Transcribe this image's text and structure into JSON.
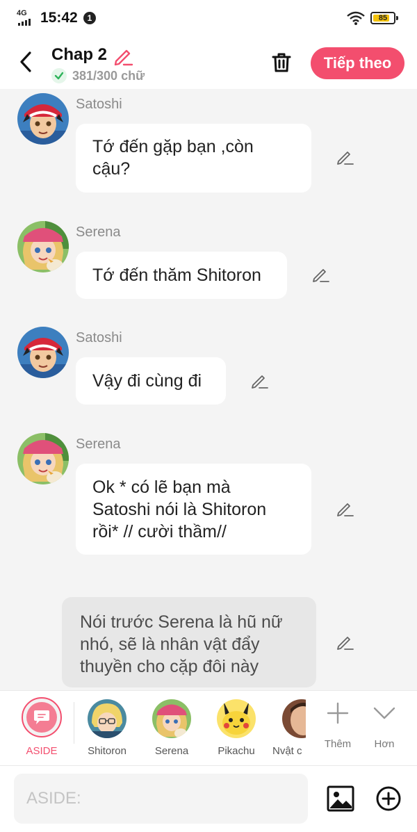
{
  "status_bar": {
    "network": "4G",
    "time": "15:42",
    "notification_count": "1",
    "battery": "85",
    "battery_level": 0.85
  },
  "header": {
    "title": "Chap 2",
    "word_count": "381/300 chữ",
    "next_label": "Tiếp theo"
  },
  "messages": [
    {
      "speaker": "Satoshi",
      "text_lines": [
        "Tớ đến gặp bạn ,còn",
        "cậu?"
      ],
      "avatar": "satoshi-avatar"
    },
    {
      "speaker": "Serena",
      "text_lines": [
        "Tớ đến thăm Shitoron"
      ],
      "avatar": "serena-avatar"
    },
    {
      "speaker": "Satoshi",
      "text_lines": [
        "Vậy đi cùng đi"
      ],
      "avatar": "satoshi-avatar"
    },
    {
      "speaker": "Serena",
      "text_lines": [
        "Ok * có lẽ bạn mà",
        "Satoshi nói là Shitoron",
        "rồi* // cười thầm//"
      ],
      "avatar": "serena-avatar"
    }
  ],
  "aside_message": {
    "text_lines": [
      "Nói trước Serena là hũ nữ",
      "nhó, sẽ là nhân vật đẩy",
      "thuyền cho cặp đôi này"
    ]
  },
  "characters": [
    {
      "label": "ASIDE",
      "selected": true
    },
    {
      "label": "Shitoron",
      "avatar": "shitoron-avatar"
    },
    {
      "label": "Serena",
      "avatar": "serena-avatar"
    },
    {
      "label": "Pikachu",
      "avatar": "pikachu-avatar"
    },
    {
      "label": "Nvật c",
      "avatar": "character-avatar"
    }
  ],
  "more": {
    "add_label": "Thêm",
    "more_label": "Hơn"
  },
  "composer": {
    "placeholder": "ASIDE:"
  },
  "colors": {
    "accent": "#f34e6e",
    "check": "#2fb35b",
    "bubble": "#ffffff",
    "aside_bubble": "#e7e7e7",
    "background": "#f4f4f4"
  }
}
